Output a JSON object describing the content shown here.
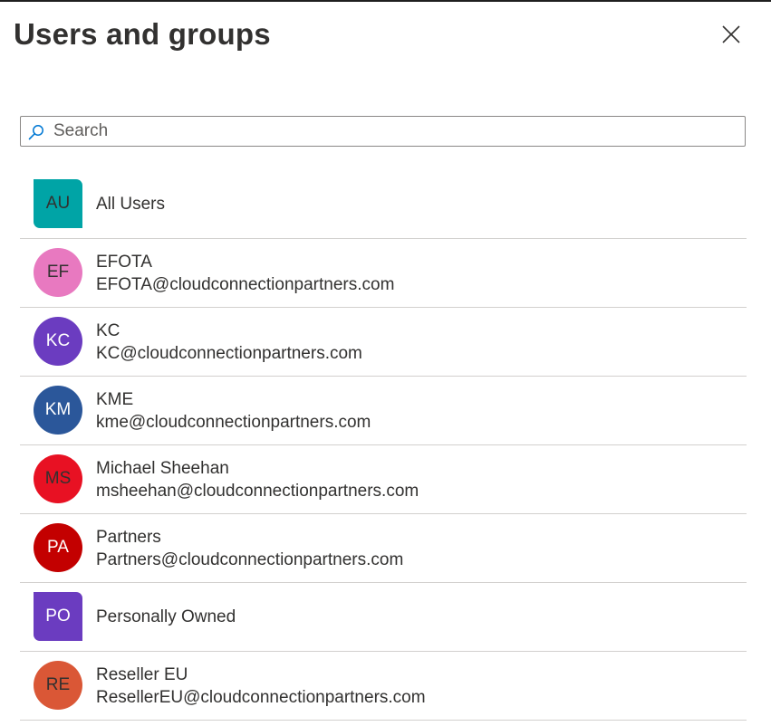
{
  "panel": {
    "title": "Users and groups"
  },
  "search": {
    "placeholder": "Search",
    "value": ""
  },
  "items": [
    {
      "initials": "AU",
      "name": "All Users",
      "email": "",
      "shape": "group",
      "color": "#00a4a6",
      "text_color": "#323130"
    },
    {
      "initials": "EF",
      "name": "EFOTA",
      "email": "EFOTA@cloudconnectionpartners.com",
      "shape": "circle",
      "color": "#e879c0",
      "text_color": "#323130"
    },
    {
      "initials": "KC",
      "name": "KC",
      "email": "KC@cloudconnectionpartners.com",
      "shape": "circle",
      "color": "#6b3cc0",
      "text_color": "#ffffff"
    },
    {
      "initials": "KM",
      "name": "KME",
      "email": "kme@cloudconnectionpartners.com",
      "shape": "circle",
      "color": "#2b579a",
      "text_color": "#ffffff"
    },
    {
      "initials": "MS",
      "name": "Michael Sheehan",
      "email": "msheehan@cloudconnectionpartners.com",
      "shape": "circle",
      "color": "#e81123",
      "text_color": "#323130"
    },
    {
      "initials": "PA",
      "name": "Partners",
      "email": "Partners@cloudconnectionpartners.com",
      "shape": "circle",
      "color": "#c30000",
      "text_color": "#ffffff"
    },
    {
      "initials": "PO",
      "name": "Personally Owned",
      "email": "",
      "shape": "group",
      "color": "#6b3cc0",
      "text_color": "#ffffff"
    },
    {
      "initials": "RE",
      "name": "Reseller EU",
      "email": "ResellerEU@cloudconnectionpartners.com",
      "shape": "circle",
      "color": "#da5736",
      "text_color": "#323130"
    }
  ],
  "icons": {
    "close": "close-icon",
    "search": "search-icon"
  },
  "colors": {
    "search_icon": "#0078d4",
    "divider": "#d2d0ce",
    "text": "#323130"
  }
}
